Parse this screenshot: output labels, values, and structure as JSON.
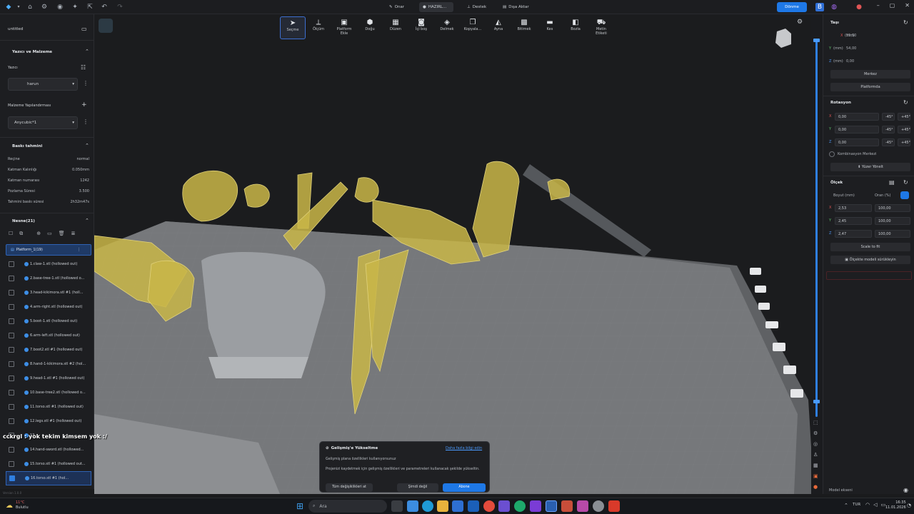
{
  "topbar": {
    "tab_prepare_left": "Onar",
    "tab_prepare": "HAZIRL...",
    "tab_support": "Destek",
    "tab_export": "Dışa Aktar",
    "upgrade_label": "Dönme"
  },
  "toolbar": [
    {
      "label": "Seçme",
      "icon": "cursor-icon"
    },
    {
      "label": "Ölçüm",
      "icon": "ruler-icon"
    },
    {
      "label": "Platform\nEkle",
      "icon": "add-platform-icon"
    },
    {
      "label": "Doğu",
      "icon": "orient-icon"
    },
    {
      "label": "Düzen",
      "icon": "layout-icon"
    },
    {
      "label": "İçi boş",
      "icon": "hollow-icon"
    },
    {
      "label": "Delmek",
      "icon": "drill-icon"
    },
    {
      "label": "Kopyala...",
      "icon": "copy-icon"
    },
    {
      "label": "Ayna",
      "icon": "mirror-icon"
    },
    {
      "label": "Bitimek",
      "icon": "merge-icon"
    },
    {
      "label": "Kes",
      "icon": "cut-icon"
    },
    {
      "label": "Bozla",
      "icon": "split-icon"
    },
    {
      "label": "Metin\nEtiketi",
      "icon": "text-label-icon"
    }
  ],
  "left": {
    "project_name": "untitled",
    "printer_material_title": "Yazıcı ve Malzeme",
    "printer_label": "Yazıcı",
    "printer_value": "harun",
    "material_config_label": "Malzeme Yapılandırması",
    "material_value": "Anycubic*1",
    "estimate_title": "Baskı tahmini",
    "estimates": [
      {
        "label": "Reçine",
        "value": "normal"
      },
      {
        "label": "Katman Kalınlığı",
        "value": "0.050mm"
      },
      {
        "label": "Katman numarası",
        "value": "1242"
      },
      {
        "label": "Pozlama Süresi",
        "value": "3.500"
      },
      {
        "label": "Tahmini baskı süresi",
        "value": "2h32m47s"
      }
    ],
    "objects_title": "Nesne(21)",
    "platform_label": "Platform_1(19)",
    "objects": [
      "1.claw-1.stl (hollowed out)",
      "2.base-tree-1.stl (hollowed o...",
      "3.head-kikimora.stl #1 (holl...",
      "4.arm-right.stl (hollowed out)",
      "5.boot-1.stl (hollowed out)",
      "6.arm-left.stl (hollowed out)",
      "7.boot2.stl #1 (hollowed out)",
      "8.hand-1-kikimora.stl #2 (hol...",
      "9.head-1.stl #1 (hollowed out)",
      "10.base-tree2.stl (hollowed o...",
      "11.torso.stl #1 (hollowed out)",
      "12.legs.stl #1 (hollowed out)",
      "13.",
      "14.hand-sword.stl (hollowed...",
      "15.torso.stl #1 (hollowed out...",
      "16.torso.stl #1 (hol..."
    ],
    "version": "Version 1.0.0"
  },
  "chat_overlay": "cckrgl : yok tekim kimsem yok :/",
  "right": {
    "move_title": "Taşı",
    "move": [
      {
        "axis": "X",
        "unit": "(mm)",
        "value": "55,50"
      },
      {
        "axis": "Y",
        "unit": "(mm)",
        "value": "54,00"
      },
      {
        "axis": "Z",
        "unit": "(mm)",
        "value": "0,00"
      }
    ],
    "center_btn": "Merkez",
    "on_platform_btn": "Platformda",
    "rotate_title": "Rotasyon",
    "rotate": [
      {
        "axis": "X",
        "value": "0,00",
        "minus": "-45°",
        "plus": "+45°"
      },
      {
        "axis": "Y",
        "value": "0,00",
        "minus": "-45°",
        "plus": "+45°"
      },
      {
        "axis": "Z",
        "value": "0,00",
        "minus": "-45°",
        "plus": "+45°"
      }
    ],
    "combo_center": "Kombinasyon Merkezi",
    "face_orient_btn": "Yüzer Yönelt",
    "scale_title": "Ölçek",
    "size_label": "Boyut (mm)",
    "ratio_label": "Oran (%)",
    "scale": [
      {
        "axis": "X",
        "size": "2,53",
        "ratio": "100,00"
      },
      {
        "axis": "Y",
        "size": "2,45",
        "ratio": "100,00"
      },
      {
        "axis": "Z",
        "size": "2,47",
        "ratio": "100,00"
      }
    ],
    "scale_fit_btn": "Scale to fit",
    "scale_slide_btn": "Ölçekte modeli sürükleyin",
    "footer_label": "Model ekseni"
  },
  "toast": {
    "title": "Gelişmiş'e Yükseltme",
    "link": "Daha fazla bilgi edin",
    "subtitle": "Gelişmiş plana özellikleri kullanıyorsunuz",
    "body": "Projenizi kaydetmek için gelişmiş özellikleri ve parametreleri kullanacak şekilde yükseltin.",
    "btn_discard": "Tüm değişiklikleri at",
    "btn_later": "Şimdi değil",
    "btn_subscribe": "Abone"
  },
  "taskbar": {
    "weather_temp": "11°C",
    "weather_desc": "Bulutlu",
    "search_placeholder": "Ara",
    "lang": "TUR",
    "time": "16:35",
    "date": "11.01.2026"
  },
  "colors": {
    "accent": "#1e78e6",
    "model_yellow": "#c9b648",
    "model_gray": "#9a9ea3",
    "plate": "#6e7073"
  }
}
